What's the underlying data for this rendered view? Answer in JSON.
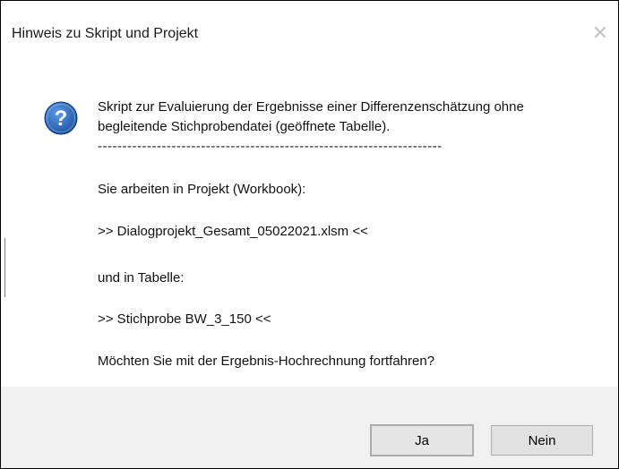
{
  "window": {
    "title": "Hinweis zu Skript und Projekt",
    "close_glyph": "✕"
  },
  "message": {
    "icon": "question-icon",
    "line1": "Skript zur Evaluierung der Ergebnisse einer Differenzenschätzung ohne",
    "line2": "begleitende Stichprobendatei (geöffnete Tabelle).",
    "separator": "----------------------------------------------------------------------",
    "project_intro": "Sie arbeiten in Projekt (Workbook):",
    "project_name": " >>  Dialogprojekt_Gesamt_05022021.xlsm  <<",
    "table_intro": "und in Tabelle:",
    "table_name": " >>  Stichprobe BW_3_150  <<",
    "question": "Möchten Sie mit der Ergebnis-Hochrechnung fortfahren?"
  },
  "buttons": {
    "yes_label": "Ja",
    "no_label": "Nein"
  },
  "colors": {
    "icon_blue": "#1e5fb4",
    "footer_bg": "#f0f0f0",
    "button_bg": "#e1e1e1"
  }
}
